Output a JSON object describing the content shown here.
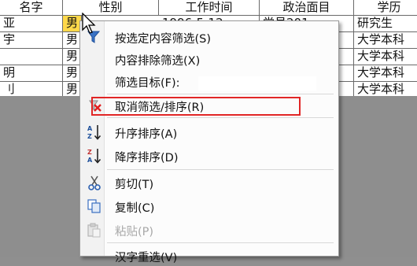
{
  "sheet": {
    "headers": [
      "名字",
      "性别",
      "工作时间",
      "政治面目",
      "学历"
    ],
    "rows": [
      {
        "name": "亚",
        "gender": "男",
        "worktime": "1996-5-12",
        "political": "党员201",
        "edu": "研究生"
      },
      {
        "name": "宇",
        "gender": "男",
        "worktime": "",
        "political": "",
        "edu": "大学本科"
      },
      {
        "name": "",
        "gender": "男",
        "worktime": "",
        "political": "",
        "edu": "大学本科"
      },
      {
        "name": "明",
        "gender": "男",
        "worktime": "",
        "political": "",
        "edu": "大学本科"
      },
      {
        "name": "刂",
        "gender": "男",
        "worktime": "",
        "political": "",
        "edu": "大学本科"
      }
    ],
    "colors": {
      "highlight": "#ffd84a",
      "background": "#8e8e8e"
    }
  },
  "menu": {
    "items": [
      {
        "label": "按选定内容筛选",
        "accel": "(S)",
        "icon": "filter-selection-icon"
      },
      {
        "label": "内容排除筛选",
        "accel": "(X)",
        "icon": ""
      },
      {
        "label": "筛选目标",
        "accel": "(F):",
        "icon": ""
      },
      {
        "label": "取消筛选/排序",
        "accel": "(R)",
        "icon": "clear-filter-icon"
      },
      {
        "label": "升序排序",
        "accel": "(A)",
        "icon": "sort-ascending-icon"
      },
      {
        "label": "降序排序",
        "accel": "(D)",
        "icon": "sort-descending-icon"
      },
      {
        "label": "剪切",
        "accel": "(T)",
        "icon": "scissors-icon"
      },
      {
        "label": "复制",
        "accel": "(C)",
        "icon": "copy-icon"
      },
      {
        "label": "粘贴",
        "accel": "(P)",
        "icon": "paste-icon",
        "disabled": true
      },
      {
        "label": "汉字重选",
        "accel": "(V)",
        "icon": ""
      }
    ],
    "highlight_color": "#e12626"
  }
}
